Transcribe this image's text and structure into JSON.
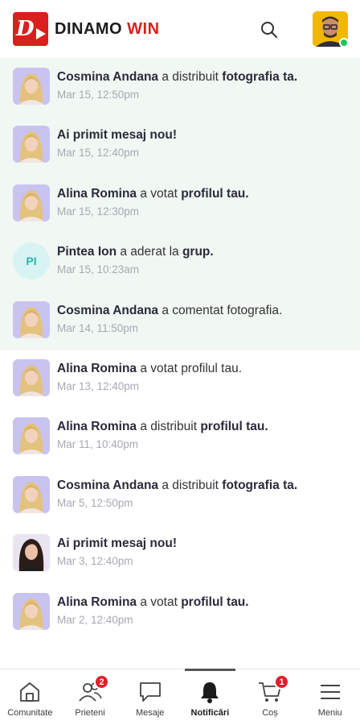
{
  "header": {
    "logo_mark": "D",
    "brand_part1": "DINAMO",
    "brand_part2": "WIN",
    "brand_color": "#d8201f",
    "search_icon": "search-icon"
  },
  "notifications": [
    {
      "avatar": "blonde-woman-portrait",
      "name": "Cosmina Andana",
      "action": " a distribuit ",
      "object": "fotografia ta.",
      "time": "Mar 15, 12:50pm",
      "unread": true
    },
    {
      "avatar": "blonde-woman-portrait",
      "name": "",
      "action": "",
      "object": "Ai primit mesaj nou!",
      "time": "Mar 15, 12:40pm",
      "unread": true
    },
    {
      "avatar": "blonde-woman-portrait",
      "name": "Alina Romina",
      "action": " a votat ",
      "object": "profilul tau.",
      "time": "Mar 15, 12:30pm",
      "unread": true
    },
    {
      "avatar": "initials",
      "initials": "PI",
      "name": "Pintea Ion",
      "action": " a aderat la ",
      "object": "grup.",
      "time": "Mar 15, 10:23am",
      "unread": true
    },
    {
      "avatar": "blonde-woman-portrait",
      "name": "Cosmina Andana",
      "action": " a comentat fotografia.",
      "object": "",
      "time": "Mar 14, 11:50pm",
      "unread": true
    },
    {
      "avatar": "blonde-woman-portrait",
      "name": "Alina Romina",
      "action": " a votat profilul tau.",
      "object": "",
      "time": "Mar 13, 12:40pm",
      "unread": false
    },
    {
      "avatar": "blonde-woman-portrait",
      "name": "Alina Romina",
      "action": " a distribuit ",
      "object": "profilul tau.",
      "time": "Mar 11, 10:40pm",
      "unread": false
    },
    {
      "avatar": "blonde-woman-portrait",
      "name": "Cosmina Andana",
      "action": " a distribuit ",
      "object": "fotografia ta.",
      "time": "Mar 5, 12:50pm",
      "unread": false
    },
    {
      "avatar": "dark-hair-woman-portrait",
      "name": "",
      "action": "",
      "object": "Ai primit mesaj nou!",
      "time": "Mar 3, 12:40pm",
      "unread": false
    },
    {
      "avatar": "blonde-woman-portrait",
      "name": "Alina Romina",
      "action": " a votat ",
      "object": "profilul tau.",
      "time": "Mar 2, 12:40pm",
      "unread": false
    }
  ],
  "nav": [
    {
      "label": "Comunitate",
      "icon": "home-icon",
      "badge": ""
    },
    {
      "label": "Prieteni",
      "icon": "friends-icon",
      "badge": "2"
    },
    {
      "label": "Mesaje",
      "icon": "chat-icon",
      "badge": ""
    },
    {
      "label": "Notificări",
      "icon": "bell-icon",
      "badge": "",
      "active": true
    },
    {
      "label": "Coș",
      "icon": "cart-icon",
      "badge": "1"
    },
    {
      "label": "Meniu",
      "icon": "menu-icon",
      "badge": ""
    }
  ],
  "colors": {
    "accent": "#d8201f",
    "unread_bg": "#f1f7f3",
    "badge": "#e21d2b",
    "online": "#22c55e",
    "avatar_bg": "#c9c3f0"
  }
}
